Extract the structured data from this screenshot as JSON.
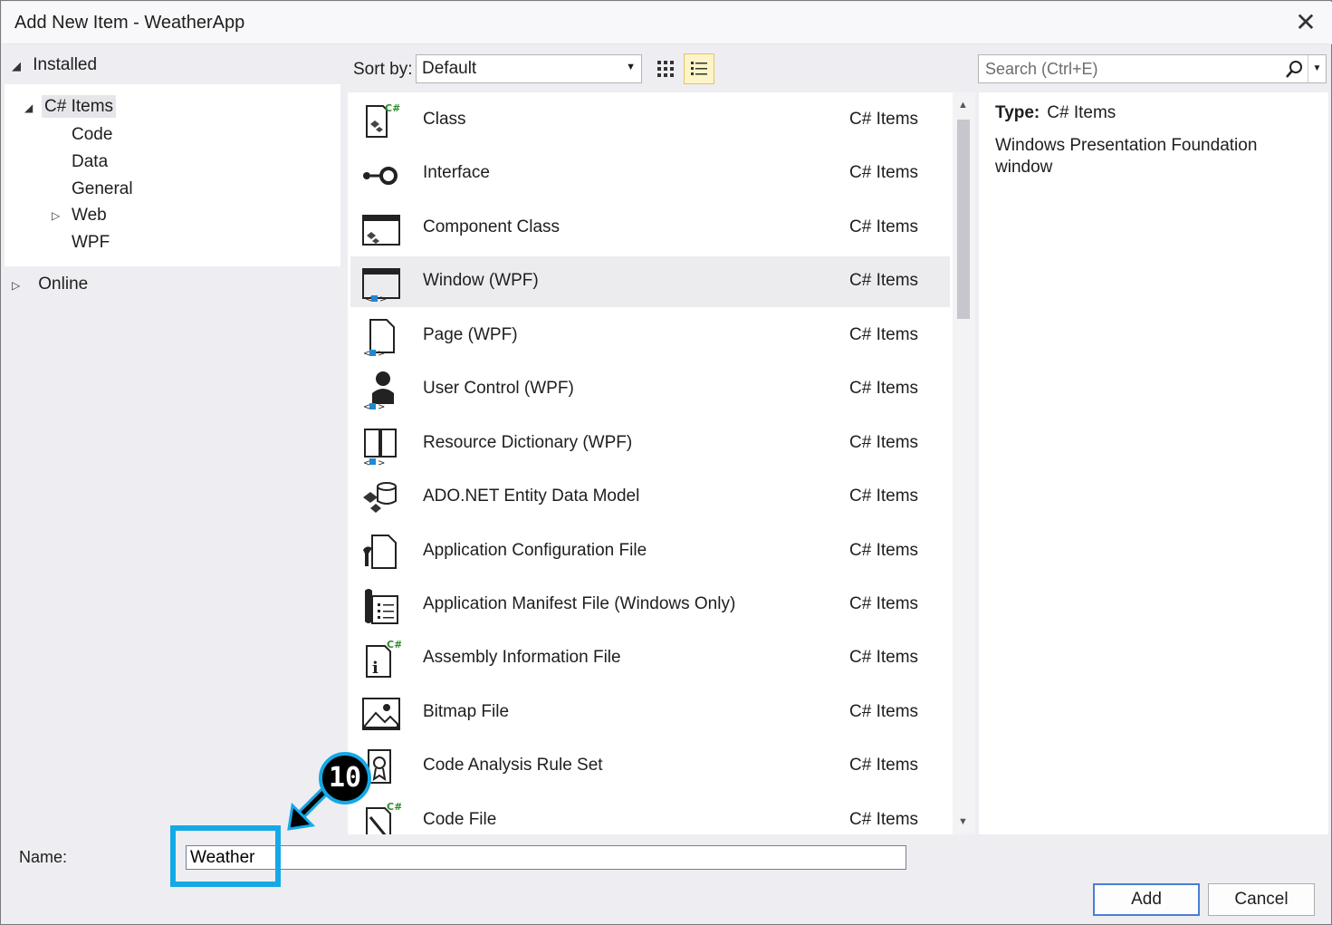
{
  "window": {
    "title": "Add New Item - WeatherApp",
    "close_glyph": "✕"
  },
  "tree": {
    "installed_label": "Installed",
    "csharp_items_label": "C# Items",
    "children": [
      "Code",
      "Data",
      "General",
      "Web",
      "WPF"
    ],
    "online_label": "Online"
  },
  "toolbar": {
    "sort_label": "Sort by:",
    "sort_value": "Default",
    "search_placeholder": "Search (Ctrl+E)"
  },
  "items": [
    {
      "name": "Class",
      "category": "C# Items",
      "icon": "class-icon"
    },
    {
      "name": "Interface",
      "category": "C# Items",
      "icon": "interface-icon"
    },
    {
      "name": "Component Class",
      "category": "C# Items",
      "icon": "component-class-icon"
    },
    {
      "name": "Window (WPF)",
      "category": "C# Items",
      "icon": "wpf-window-icon",
      "selected": true
    },
    {
      "name": "Page (WPF)",
      "category": "C# Items",
      "icon": "wpf-page-icon"
    },
    {
      "name": "User Control (WPF)",
      "category": "C# Items",
      "icon": "user-control-icon"
    },
    {
      "name": "Resource Dictionary (WPF)",
      "category": "C# Items",
      "icon": "resource-dictionary-icon"
    },
    {
      "name": "ADO.NET Entity Data Model",
      "category": "C# Items",
      "icon": "entity-data-model-icon"
    },
    {
      "name": "Application Configuration File",
      "category": "C# Items",
      "icon": "config-file-icon"
    },
    {
      "name": "Application Manifest File (Windows Only)",
      "category": "C# Items",
      "icon": "manifest-file-icon"
    },
    {
      "name": "Assembly Information File",
      "category": "C# Items",
      "icon": "assembly-info-icon"
    },
    {
      "name": "Bitmap File",
      "category": "C# Items",
      "icon": "bitmap-icon"
    },
    {
      "name": "Code Analysis Rule Set",
      "category": "C# Items",
      "icon": "rule-set-icon"
    },
    {
      "name": "Code File",
      "category": "C# Items",
      "icon": "code-file-icon"
    }
  ],
  "details": {
    "type_label": "Type:",
    "type_value": "C# Items",
    "description": "Windows Presentation Foundation window"
  },
  "footer": {
    "name_label": "Name:",
    "name_value": "Weather",
    "add_label": "Add",
    "cancel_label": "Cancel"
  },
  "callout": {
    "step_number": "10",
    "color": "#14a9e6"
  },
  "colors": {
    "selected_row": "#ececef",
    "accent_blue": "#1e88d4",
    "csharp_green": "#2e8b2e"
  }
}
